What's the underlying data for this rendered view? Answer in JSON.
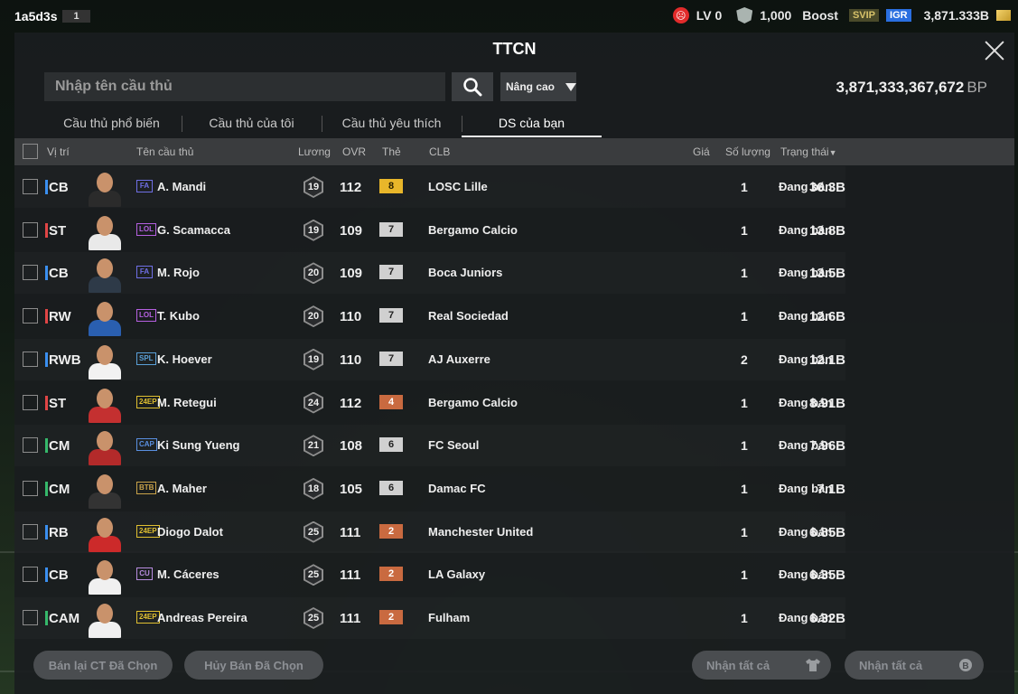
{
  "topbar": {
    "user_id": "1a5d3s",
    "user_num": "1",
    "level": "LV 0",
    "shield_value": "1,000",
    "boost_label": "Boost",
    "svip": "SVIP",
    "igr": "IGR",
    "balance": "3,871.333B"
  },
  "panel": {
    "title": "TTCN",
    "search_placeholder": "Nhập tên cầu thủ",
    "advanced_label": "Nâng cao",
    "bp_value": "3,871,333,367,672",
    "bp_unit": "BP"
  },
  "tabs": [
    {
      "label": "Cầu thủ phổ biến"
    },
    {
      "label": "Cầu thủ của tôi"
    },
    {
      "label": "Cầu thủ yêu thích"
    },
    {
      "label": "DS của bạn"
    }
  ],
  "table": {
    "headers": {
      "position": "Vị trí",
      "name": "Tên cầu thủ",
      "wage": "Lương",
      "ovr": "OVR",
      "card": "Thẻ",
      "club": "CLB",
      "price": "Giá",
      "quantity": "Số lượng",
      "status": "Trạng thái"
    },
    "rows": [
      {
        "pos": "CB",
        "pos_color": "#3a8ff0",
        "season": "FA",
        "season_color": "#6f6fe6",
        "name": "A. Mandi",
        "wage": "19",
        "ovr": "112",
        "grade": "8",
        "grade_bg": "#e8b62a",
        "grade_fg": "#2a2000",
        "club": "LOSC Lille",
        "price": "36.3B",
        "qty": "1",
        "status": "Đang bán",
        "shirt": "#2b2b2b"
      },
      {
        "pos": "ST",
        "pos_color": "#e04545",
        "season": "LOL",
        "season_color": "#b560e0",
        "name": "G. Scamacca",
        "wage": "19",
        "ovr": "109",
        "grade": "7",
        "grade_bg": "#d0d0d0",
        "grade_fg": "#222",
        "club": "Bergamo Calcio",
        "price": "13.8B",
        "qty": "1",
        "status": "Đang bán",
        "shirt": "#e9e9e9"
      },
      {
        "pos": "CB",
        "pos_color": "#3a8ff0",
        "season": "FA",
        "season_color": "#6f6fe6",
        "name": "M. Rojo",
        "wage": "20",
        "ovr": "109",
        "grade": "7",
        "grade_bg": "#d0d0d0",
        "grade_fg": "#222",
        "club": "Boca Juniors",
        "price": "13.5B",
        "qty": "1",
        "status": "Đang bán",
        "shirt": "#2e3a48"
      },
      {
        "pos": "RW",
        "pos_color": "#e04545",
        "season": "LOL",
        "season_color": "#b560e0",
        "name": "T. Kubo",
        "wage": "20",
        "ovr": "110",
        "grade": "7",
        "grade_bg": "#d0d0d0",
        "grade_fg": "#222",
        "club": "Real Sociedad",
        "price": "12.6B",
        "qty": "1",
        "status": "Đang bán",
        "shirt": "#2a5fb0"
      },
      {
        "pos": "RWB",
        "pos_color": "#3a8ff0",
        "season": "SPL",
        "season_color": "#5aa0d8",
        "name": "K. Hoever",
        "wage": "19",
        "ovr": "110",
        "grade": "7",
        "grade_bg": "#d0d0d0",
        "grade_fg": "#222",
        "club": "AJ Auxerre",
        "price": "12.1B",
        "qty": "2",
        "status": "Đang bán",
        "shirt": "#f2f2f2"
      },
      {
        "pos": "ST",
        "pos_color": "#e04545",
        "season": "24EP",
        "season_color": "#e0c030",
        "name": "M. Retegui",
        "wage": "24",
        "ovr": "112",
        "grade": "4",
        "grade_bg": "#c96a40",
        "grade_fg": "#fff",
        "club": "Bergamo Calcio",
        "price": "8.91B",
        "qty": "1",
        "status": "Đang bán",
        "shirt": "#c43030"
      },
      {
        "pos": "CM",
        "pos_color": "#35b86a",
        "season": "CAP",
        "season_color": "#5a8fe0",
        "name": "Ki Sung Yueng",
        "wage": "21",
        "ovr": "108",
        "grade": "6",
        "grade_bg": "#d0d0d0",
        "grade_fg": "#222",
        "club": "FC Seoul",
        "price": "7.96B",
        "qty": "1",
        "status": "Đang bán",
        "shirt": "#b32a2a"
      },
      {
        "pos": "CM",
        "pos_color": "#35b86a",
        "season": "BTB",
        "season_color": "#c9a34a",
        "name": "A. Maher",
        "wage": "18",
        "ovr": "105",
        "grade": "6",
        "grade_bg": "#d0d0d0",
        "grade_fg": "#222",
        "club": "Damac FC",
        "price": "7.1B",
        "qty": "1",
        "status": "Đang bán",
        "shirt": "#333"
      },
      {
        "pos": "RB",
        "pos_color": "#3a8ff0",
        "season": "24EP",
        "season_color": "#e0c030",
        "name": "Diogo Dalot",
        "wage": "25",
        "ovr": "111",
        "grade": "2",
        "grade_bg": "#c96a40",
        "grade_fg": "#fff",
        "club": "Manchester United",
        "price": "6.85B",
        "qty": "1",
        "status": "Đang bán",
        "shirt": "#cc2a2a"
      },
      {
        "pos": "CB",
        "pos_color": "#3a8ff0",
        "season": "CU",
        "season_color": "#b88de0",
        "name": "M. Cáceres",
        "wage": "25",
        "ovr": "111",
        "grade": "2",
        "grade_bg": "#c96a40",
        "grade_fg": "#fff",
        "club": "LA Galaxy",
        "price": "6.35B",
        "qty": "1",
        "status": "Đang bán",
        "shirt": "#f0f0f0"
      },
      {
        "pos": "CAM",
        "pos_color": "#35b86a",
        "season": "24EP",
        "season_color": "#e0c030",
        "name": "Andreas Pereira",
        "wage": "25",
        "ovr": "111",
        "grade": "2",
        "grade_bg": "#c96a40",
        "grade_fg": "#fff",
        "club": "Fulham",
        "price": "6.32B",
        "qty": "1",
        "status": "Đang bán",
        "shirt": "#f0f0f0"
      }
    ]
  },
  "footer": {
    "resell_label": "Bán lại CT Đã Chọn",
    "cancel_label": "Hủy Bán Đã Chọn",
    "receive_all_1": "Nhận tất cả",
    "receive_all_2": "Nhận tất cả"
  }
}
